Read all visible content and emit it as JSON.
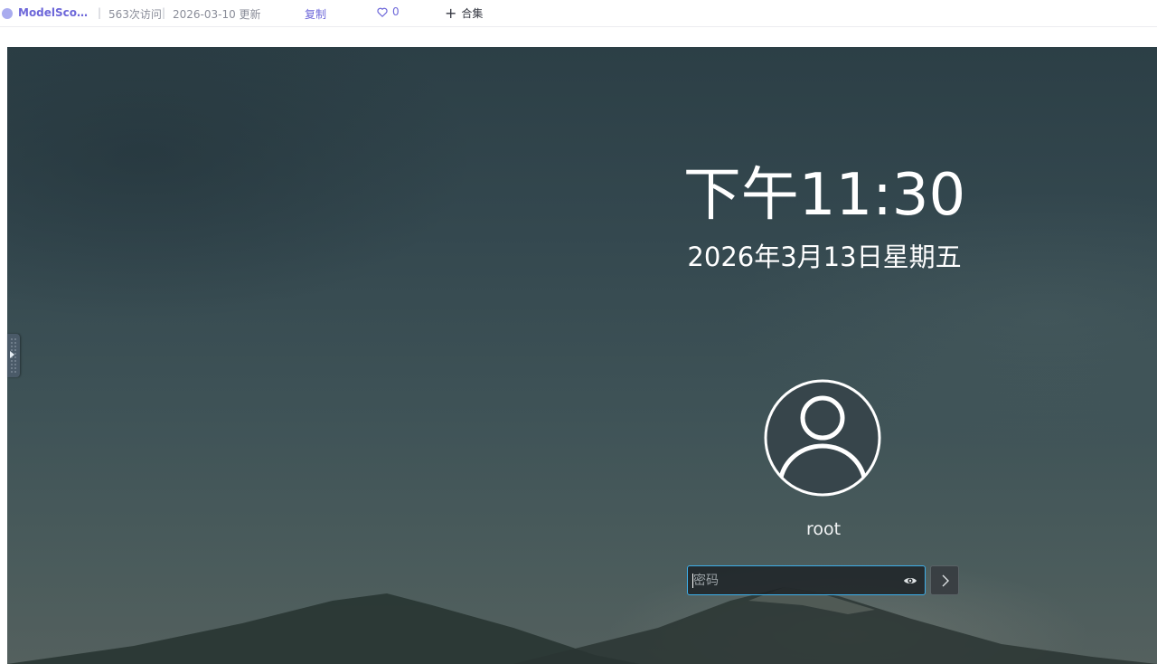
{
  "topbar": {
    "site_name": "ModelScope...",
    "separator": "|",
    "visits": "563次访问",
    "updated": "2026-03-10 更新",
    "copy_label": "复制",
    "like_count": "0",
    "collect_label": "合集",
    "accent_color": "#6d67d9"
  },
  "lockscreen": {
    "time": "下午11:30",
    "date": "2026年3月13日星期五",
    "user_icon": "user-avatar-icon",
    "username": "root",
    "password": {
      "value": "",
      "placeholder": "密码",
      "reveal_icon": "eye-icon",
      "focus_color": "#3daee9"
    },
    "submit_icon": "chevron-right-icon",
    "side_panel_icon": "triangle-right-icon"
  }
}
